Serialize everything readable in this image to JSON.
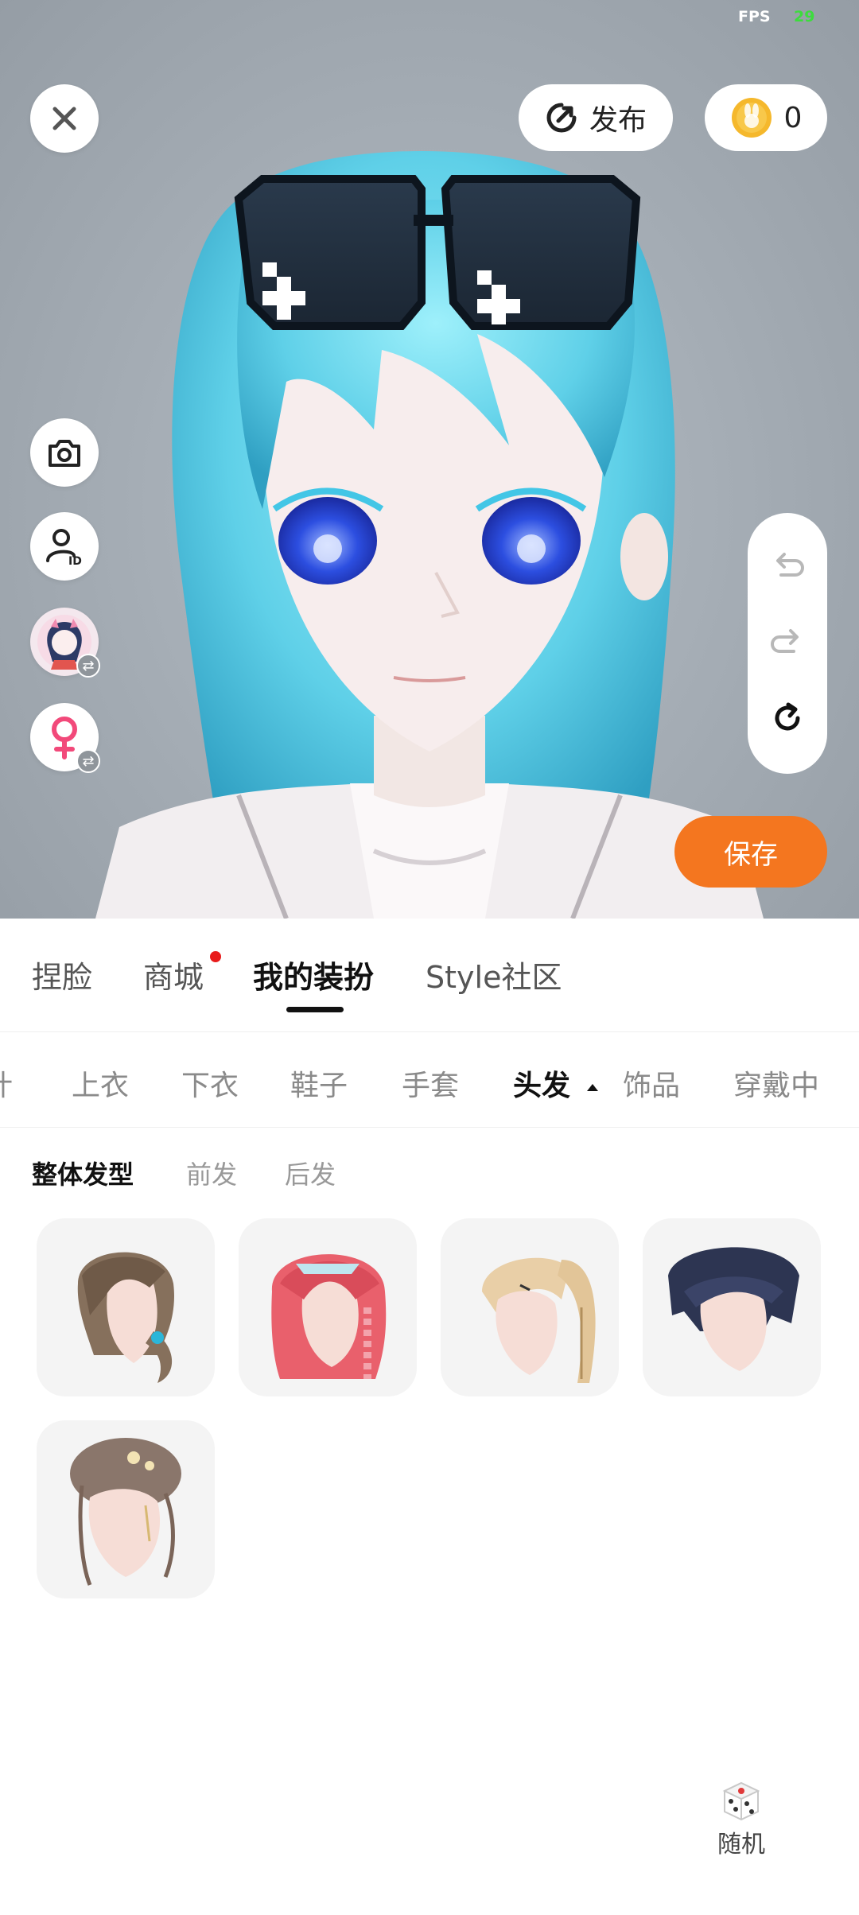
{
  "status": {
    "fps_label": "FPS",
    "fps_value": "29"
  },
  "toolbar": {
    "publish_label": "发布",
    "coins": "0",
    "save_label": "保存"
  },
  "main_tabs": [
    "捏脸",
    "商城",
    "我的装扮",
    "Style社区"
  ],
  "categories": [
    "计",
    "上衣",
    "下衣",
    "鞋子",
    "手套",
    "头发",
    "饰品",
    "穿戴中"
  ],
  "active_category": "头发",
  "sub_tabs": [
    "整体发型",
    "前发",
    "后发"
  ],
  "items": [
    {
      "name": "brown-low-ponytail-hair"
    },
    {
      "name": "pink-braided-tiara-hair"
    },
    {
      "name": "blonde-high-ponytail-hair"
    },
    {
      "name": "navy-short-hair"
    },
    {
      "name": "brown-updo-hair"
    }
  ],
  "random_label": "随机",
  "colors": {
    "accent": "#f4761f",
    "badge": "#e81b1b",
    "fps_value": "#3ddc3d"
  },
  "icons": [
    "close-icon",
    "publish-icon",
    "coin-icon",
    "camera-icon",
    "avatar-id-icon",
    "character-swap-icon",
    "gender-female-icon",
    "undo-icon",
    "redo-icon",
    "reset-icon",
    "dice-icon"
  ]
}
